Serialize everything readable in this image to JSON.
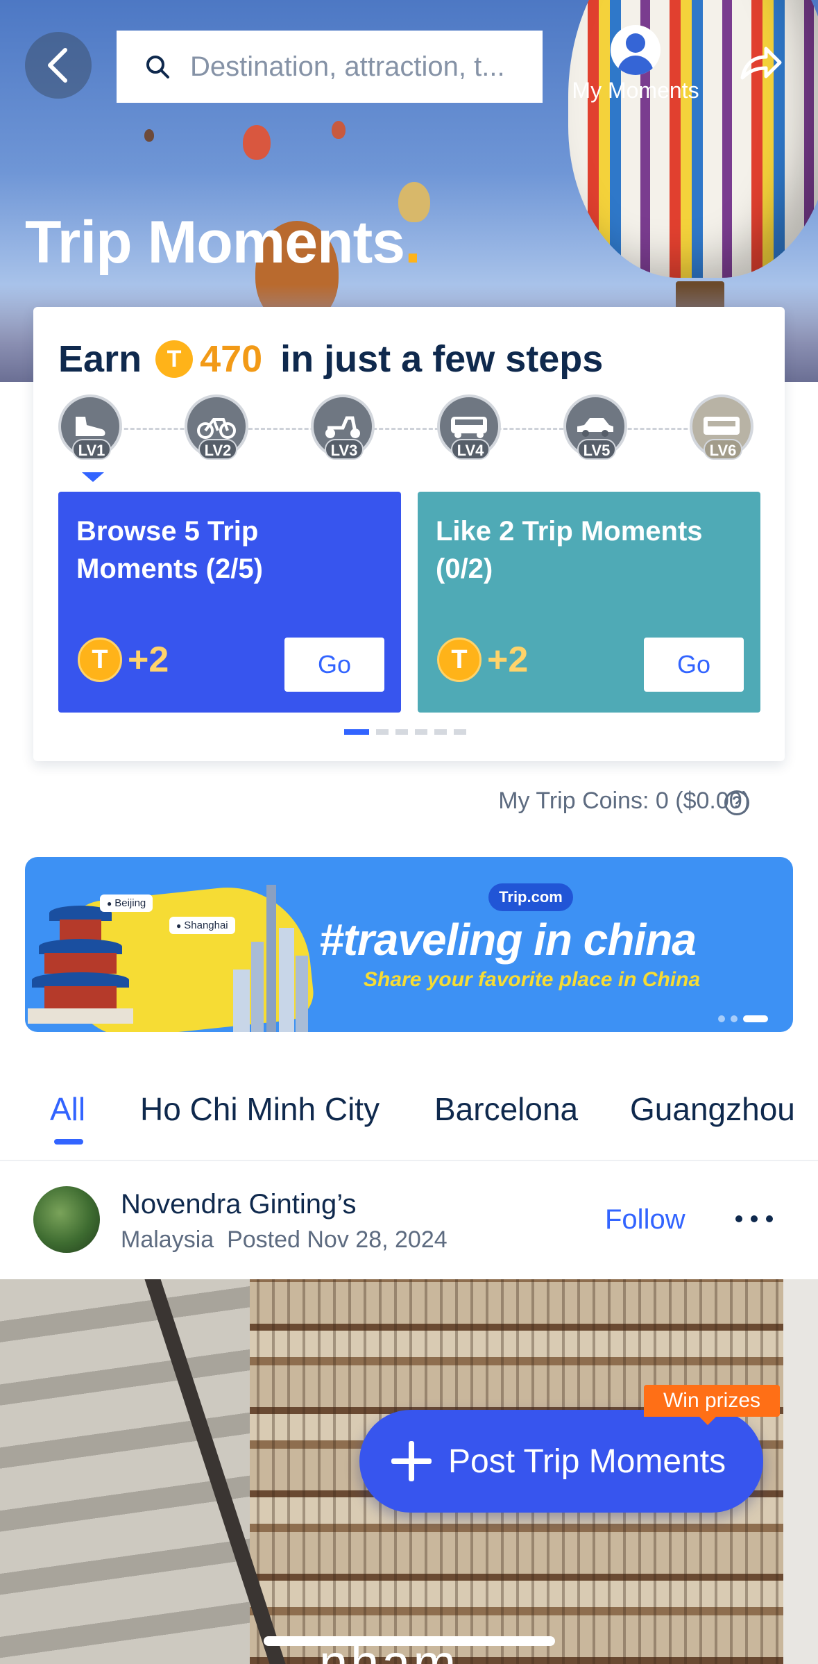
{
  "header": {
    "search_placeholder": "Destination, attraction, t...",
    "my_moments_label": "My Moments",
    "title": "Trip Moments",
    "title_dot": "."
  },
  "earn": {
    "prefix": "Earn",
    "coin_symbol": "T",
    "amount": "470",
    "suffix": "in just a few steps",
    "levels": [
      "LV1",
      "LV2",
      "LV3",
      "LV4",
      "LV5",
      "LV6"
    ],
    "level_icons": [
      "sneaker-icon",
      "bicycle-icon",
      "scooter-icon",
      "bus-icon",
      "car-icon",
      "train-icon"
    ],
    "tasks": [
      {
        "title": "Browse 5 Trip Moments (2/5)",
        "reward": "+2",
        "button": "Go"
      },
      {
        "title": "Like 2 Trip Moments (0/2)",
        "reward": "+2",
        "button": "Go"
      }
    ],
    "page_count": 6,
    "page_active": 1
  },
  "coins": {
    "text": "My Trip Coins: 0 ($0.00)",
    "help": "?"
  },
  "banner": {
    "pin_beijing": "Beijing",
    "pin_shanghai": "Shanghai",
    "badge": "Trip.com",
    "title": "#traveling in china",
    "subtitle": "Share your favorite place in China",
    "slide_count": 3,
    "slide_active": 3
  },
  "tabs": [
    {
      "label": "All",
      "active": true
    },
    {
      "label": "Ho Chi Minh City",
      "active": false
    },
    {
      "label": "Barcelona",
      "active": false
    },
    {
      "label": "Guangzhou",
      "active": false
    }
  ],
  "post": {
    "author": "Novendra Ginting’s",
    "country": "Malaysia",
    "posted": "Posted Nov 28, 2024",
    "follow_label": "Follow",
    "caption_peek": "nham"
  },
  "fab": {
    "label": "Post Trip Moments",
    "badge": "Win prizes"
  },
  "colors": {
    "accent": "#3264ff",
    "task_blue": "#3755ee",
    "task_teal": "#4faab6",
    "coin": "#ffb319",
    "badge_orange": "#ff6f16",
    "text_dark": "#0f294d"
  }
}
